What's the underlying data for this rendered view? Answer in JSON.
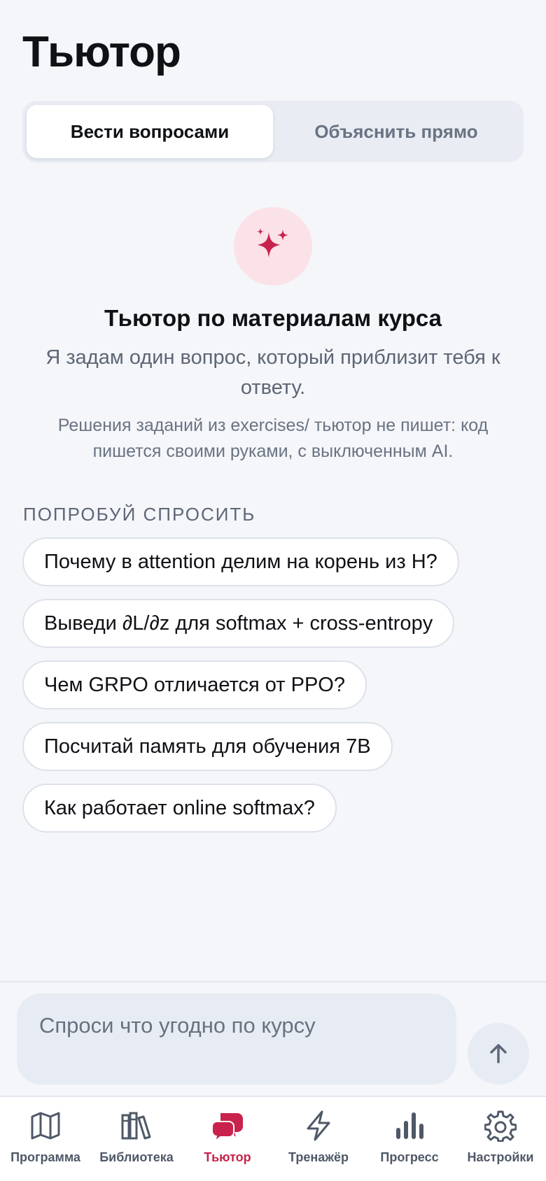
{
  "header": {
    "title": "Тьютор"
  },
  "mode_toggle": {
    "options": [
      {
        "label": "Вести вопросами",
        "active": true
      },
      {
        "label": "Объяснить прямо",
        "active": false
      }
    ]
  },
  "hero": {
    "icon": "sparkles-icon",
    "title": "Тьютор по материалам курса",
    "subtitle": "Я задам один вопрос, который приблизит тебя к ответу.",
    "note": "Решения заданий из exercises/ тьютор не пишет: код пишется своими руками, с выключенным AI."
  },
  "suggestions": {
    "label": "ПОПРОБУЙ СПРОСИТЬ",
    "items": [
      "Почему в attention делим на корень из H?",
      "Выведи ∂L/∂z для softmax + cross-entropy",
      "Чем GRPO отличается от PPO?",
      "Посчитай память для обучения 7B",
      "Как работает online softmax?"
    ]
  },
  "composer": {
    "placeholder": "Спроси что угодно по курсу",
    "send_icon": "arrow-up-icon"
  },
  "tabbar": {
    "items": [
      {
        "label": "Программа",
        "icon": "map-icon",
        "active": false
      },
      {
        "label": "Библиотека",
        "icon": "books-icon",
        "active": false
      },
      {
        "label": "Тьютор",
        "icon": "chat-bubbles-icon",
        "active": true
      },
      {
        "label": "Тренажёр",
        "icon": "lightning-icon",
        "active": false
      },
      {
        "label": "Прогресс",
        "icon": "bar-chart-icon",
        "active": false
      },
      {
        "label": "Настройки",
        "icon": "gear-icon",
        "active": false
      }
    ]
  },
  "colors": {
    "accent": "#c8234c",
    "accent_soft": "#fbe1e8",
    "background": "#f4f6f9",
    "muted_text": "#5d6676"
  }
}
